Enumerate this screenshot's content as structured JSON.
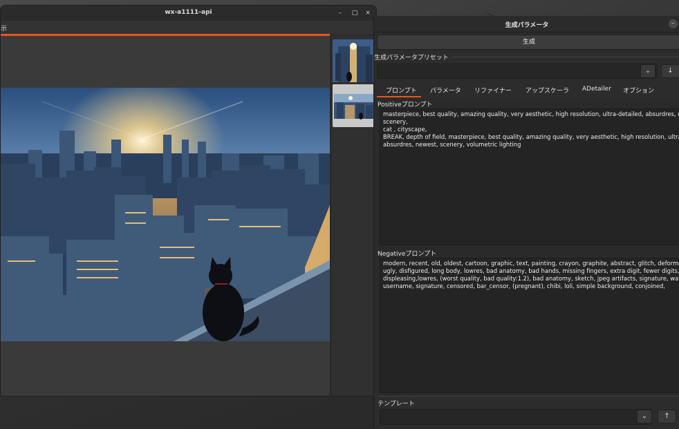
{
  "image_window": {
    "title": "wx-a1111-api",
    "menu_fragment": "示",
    "controls": {
      "minimize": "–",
      "maximize": "□",
      "close": "×"
    }
  },
  "param_window": {
    "title": "生成パラメータ",
    "minimize": "–",
    "generate_label": "生成",
    "preset_label": "生成パラメータプリセット",
    "preset_value": "",
    "dropdown_glyph": "⌄",
    "download_glyph": "↓",
    "tabs": [
      {
        "label": "プロンプト",
        "active": true
      },
      {
        "label": "パラメータ"
      },
      {
        "label": "リファイナー"
      },
      {
        "label": "アップスケーラ"
      },
      {
        "label": "ADetailer"
      },
      {
        "label": "オプション"
      }
    ],
    "positive_label": "Positiveプロンプト",
    "positive_text": "masterpiece, best quality, amazing quality, very aesthetic, high resolution, ultra-detailed, absurdres, newest,\nscenery,\ncat , cityscape,\nBREAK, depth of field, masterpiece, best quality, amazing quality, very aesthetic, high resolution, ultra-detai\nabsurdres, newest, scenery, volumetric lighting",
    "negative_label": "Negativeプロンプト",
    "negative_text": "modern, recent, old, oldest, cartoon, graphic, text, painting, crayon, graphite, abstract, glitch, deformed, m\nugly, disfigured, long body, lowres, bad anatomy, bad hands, missing fingers, extra digit, fewer digits, croppe\ndispleasing,lowres, (worst quality, bad quality:1.2), bad anatomy, sketch, jpeg artifacts, signature, waterma\nusername, signature, censored, bar_censor, (pregnant), chibi, loli, simple background, conjoined,",
    "template_label": "テンプレート",
    "template_value": "",
    "upload_glyph": "↑"
  },
  "colors": {
    "accent": "#e95420",
    "panel": "#2c2c2c",
    "field": "#242424"
  },
  "icons": [
    "minimize-icon",
    "maximize-icon",
    "close-icon",
    "chevron-down-icon",
    "download-arrow-icon",
    "upload-arrow-icon"
  ]
}
